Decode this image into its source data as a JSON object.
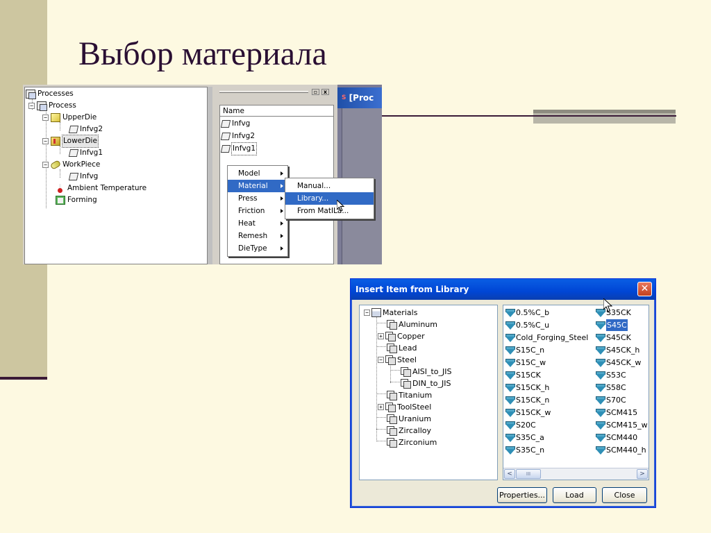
{
  "slide": {
    "title": "Выбор материала"
  },
  "process_tree": {
    "root": "Processes",
    "process": "Process",
    "upper_die": "UpperDie",
    "upper_die_child": "Infvg2",
    "lower_die": "LowerDie",
    "lower_die_child": "Infvg1",
    "workpiece": "WorkPiece",
    "workpiece_child": "Infvg",
    "ambient": "Ambient Temperature",
    "forming": "Forming"
  },
  "name_panel": {
    "header": "Name",
    "items": [
      "Infvg",
      "Infvg2",
      "Infvg1"
    ],
    "btn_min": "▫",
    "btn_close": "x"
  },
  "main_window": {
    "title": "[Proc"
  },
  "context_menu": {
    "items": [
      "Model",
      "Material",
      "Press",
      "Friction",
      "Heat",
      "Remesh",
      "DieType"
    ],
    "active": "Material"
  },
  "submenu": {
    "items": [
      "Manual...",
      "Library...",
      "From MatILa..."
    ],
    "active": "Library..."
  },
  "dialog": {
    "title": "Insert Item from Library",
    "close_glyph": "✕",
    "tree": {
      "root": "Materials",
      "items": [
        "Aluminum",
        "Copper",
        "Lead",
        "Steel",
        "AISI_to_JIS",
        "DIN_to_JIS",
        "Titanium",
        "ToolSteel",
        "Uranium",
        "Zircalloy",
        "Zirconium"
      ]
    },
    "list_col1": [
      "0.5%C_b",
      "0.5%C_u",
      "Cold_Forging_Steel",
      "S15C_n",
      "S15C_w",
      "S15CK",
      "S15CK_h",
      "S15CK_n",
      "S15CK_w",
      "S20C",
      "S35C_a",
      "S35C_n"
    ],
    "list_col2": [
      "S35CK",
      "S45C",
      "S45CK",
      "S45CK_h",
      "S45CK_w",
      "S53C",
      "S58C",
      "S70C",
      "SCM415",
      "SCM415_w",
      "SCM440",
      "SCM440_h"
    ],
    "selected_item": "S45C",
    "scroll_thumb": "III",
    "scroll_left": "<",
    "scroll_right": ">",
    "buttons": {
      "properties": "Properties...",
      "load": "Load",
      "close": "Close"
    }
  },
  "colors": {
    "slide_bg": "#fdf9e1",
    "accent_band": "#cdc6a0",
    "title_color": "#2a0f33",
    "selection": "#316ac5",
    "xp_title": "#0a5ee4"
  }
}
